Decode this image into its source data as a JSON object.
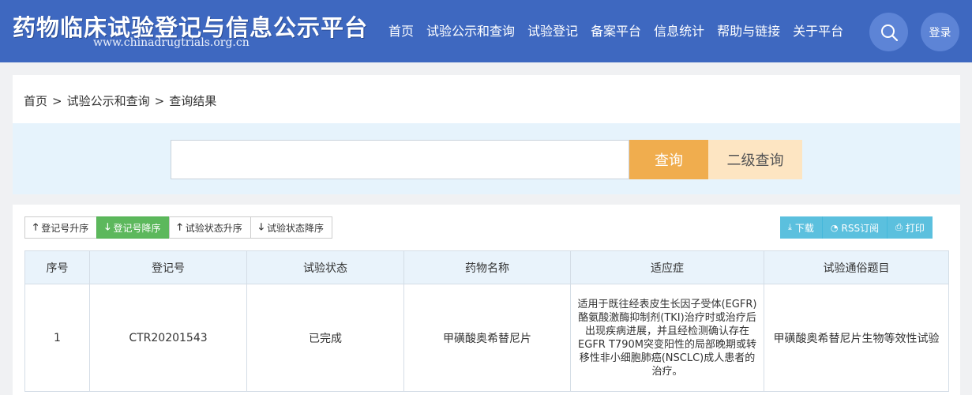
{
  "header": {
    "title": "药物临床试验登记与信息公示平台",
    "url": "www.chinadrugtrials.org.cn",
    "nav": [
      "首页",
      "试验公示和查询",
      "试验登记",
      "备案平台",
      "信息统计",
      "帮助与链接",
      "关于平台"
    ],
    "search_icon": "search-icon",
    "login_label": "登录"
  },
  "breadcrumb": [
    "首页",
    "试验公示和查询",
    "查询结果"
  ],
  "breadcrumb_separator": ">",
  "search": {
    "value": "",
    "placeholder": "",
    "query_label": "查询",
    "advanced_label": "二级查询"
  },
  "sort_buttons": [
    {
      "label": "登记号升序",
      "icon": "arrow-up-icon"
    },
    {
      "label": "登记号降序",
      "icon": "arrow-down-icon",
      "active": true
    },
    {
      "label": "试验状态升序",
      "icon": "arrow-up-icon"
    },
    {
      "label": "试验状态降序",
      "icon": "arrow-down-icon"
    }
  ],
  "actions": [
    {
      "label": "下载",
      "icon": "download-icon"
    },
    {
      "label": "RSS订阅",
      "icon": "rss-icon"
    },
    {
      "label": "打印",
      "icon": "print-icon"
    }
  ],
  "table": {
    "headers": [
      "序号",
      "登记号",
      "试验状态",
      "药物名称",
      "适应症",
      "试验通俗题目"
    ],
    "rows": [
      {
        "index": "1",
        "reg_no": "CTR20201543",
        "status": "已完成",
        "drug": "甲磺酸奥希替尼片",
        "indication": "适用于既往经表皮生长因子受体(EGFR)酪氨酸激酶抑制剂(TKI)治疗时或治疗后出现疾病进展，并且经检测确认存在EGFR T790M突变阳性的局部晚期或转移性非小细胞肺癌(NSCLC)成人患者的治疗。",
        "title": "甲磺酸奥希替尼片生物等效性试验"
      }
    ]
  },
  "colors": {
    "header_bg": "#3e68c0",
    "query_btn": "#f0ad4e",
    "advanced_btn": "#fde5c2",
    "active_sort": "#5cb85c",
    "action_btn": "#5bc0de"
  }
}
